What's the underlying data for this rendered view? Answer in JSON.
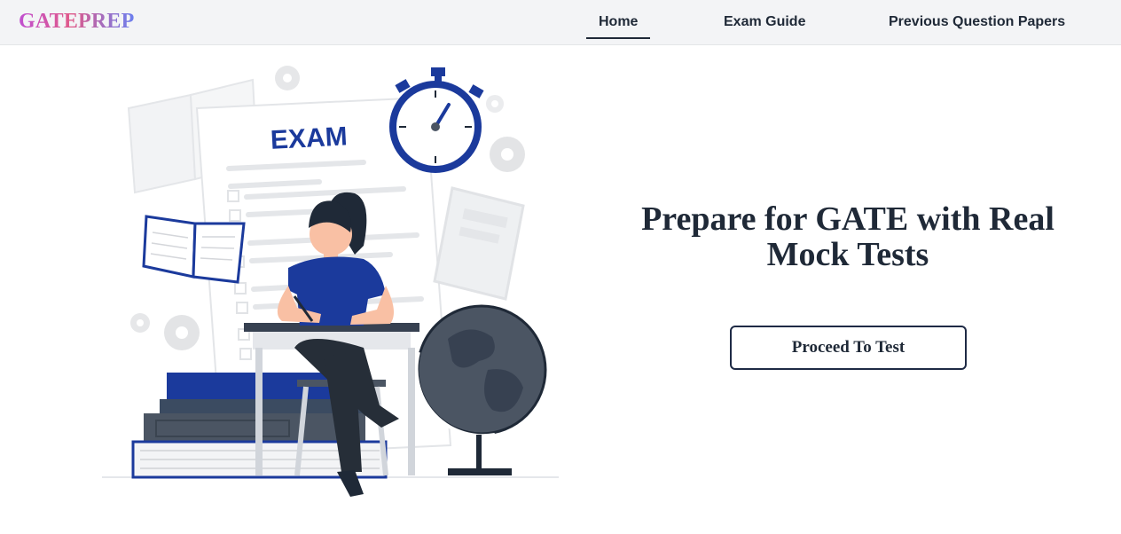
{
  "brand": {
    "logo_text": "GATEPREP"
  },
  "nav": {
    "items": [
      {
        "label": "Home",
        "active": true
      },
      {
        "label": "Exam Guide",
        "active": false
      },
      {
        "label": "Previous Question Papers",
        "active": false
      }
    ]
  },
  "hero": {
    "title": "Prepare for GATE with Real Mock Tests",
    "cta_label": "Proceed To Test",
    "illustration_text": "EXAM"
  },
  "colors": {
    "accent_blue": "#1b3a9c",
    "text_dark": "#1f2937",
    "navbar_bg": "#f3f4f6"
  },
  "icons": [
    "gear-icon",
    "stopwatch-icon",
    "globe-icon",
    "book-icon",
    "tablet-icon"
  ]
}
